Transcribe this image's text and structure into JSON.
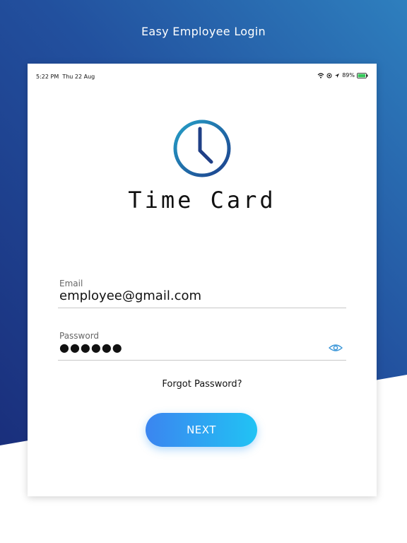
{
  "header": {
    "title": "Easy Employee Login"
  },
  "status_bar": {
    "time": "5:22 PM",
    "date": "Thu 22 Aug",
    "battery": "89%"
  },
  "brand": {
    "name": "Time Card"
  },
  "form": {
    "email": {
      "label": "Email",
      "value": "employee@gmail.com"
    },
    "password": {
      "label": "Password",
      "value": "●●●●●●"
    }
  },
  "links": {
    "forgot": "Forgot Password?"
  },
  "buttons": {
    "next": "NEXT"
  },
  "colors": {
    "brand_blue": "#2196c9",
    "bg_dark": "#1b3a8a",
    "button_start": "#3b85f0",
    "button_end": "#21c3f4"
  },
  "icons": [
    "clock-icon",
    "wifi-icon",
    "location-icon",
    "battery-icon",
    "eye-icon"
  ]
}
